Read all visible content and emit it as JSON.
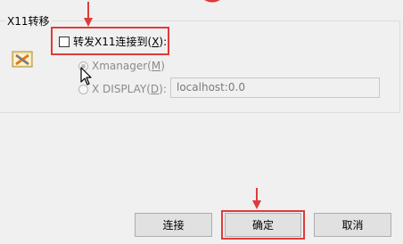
{
  "group": {
    "title": "X11转移"
  },
  "forward": {
    "label": "转发X11连接到(",
    "hotkey": "X",
    "suffix": "):",
    "checked": false
  },
  "options": [
    {
      "label": "Xmanager(",
      "hotkey": "M",
      "suffix": ")",
      "selected": true
    },
    {
      "label": "X DISPLAY(",
      "hotkey": "D",
      "suffix": "):",
      "selected": false
    }
  ],
  "display_field": {
    "value": "localhost:0.0"
  },
  "buttons": {
    "connect": "连接",
    "ok": "确定",
    "cancel": "取消"
  },
  "colors": {
    "highlight": "#e03a3a",
    "disabled_text": "#8a8a8a"
  },
  "icons": {
    "app": "xmanager-app-icon",
    "cursor": "mouse-pointer-icon"
  }
}
